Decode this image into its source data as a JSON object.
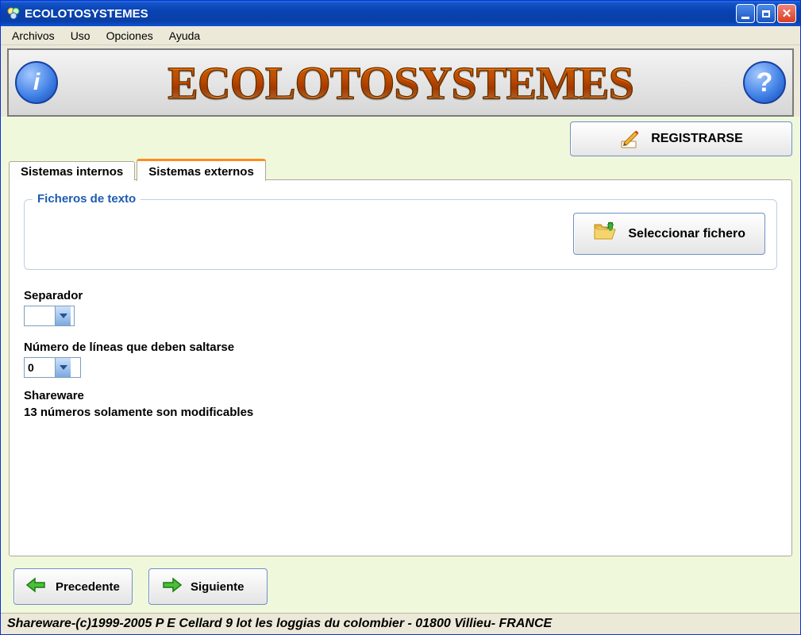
{
  "window": {
    "title": "ECOLOTOSYSTEMES"
  },
  "menu": {
    "items": [
      "Archivos",
      "Uso",
      "Opciones",
      "Ayuda"
    ]
  },
  "banner": {
    "title": "ECOLOTOSYSTEMES"
  },
  "register": {
    "label": "REGISTRARSE"
  },
  "tabs": {
    "internal": "Sistemas internos",
    "external": "Sistemas externos"
  },
  "panel": {
    "group_title": "Ficheros de texto",
    "select_file": "Seleccionar fichero",
    "separator_label": "Separador",
    "separator_value": "",
    "skip_label": "Número de líneas que deben saltarse",
    "skip_value": "0",
    "shareware_line1": "Shareware",
    "shareware_line2": "13 números solamente son modificables"
  },
  "nav": {
    "prev": "Precedente",
    "next": "Siguiente"
  },
  "status": "Shareware-(c)1999-2005 P E Cellard 9 lot les loggias du colombier - 01800 Villieu- FRANCE"
}
